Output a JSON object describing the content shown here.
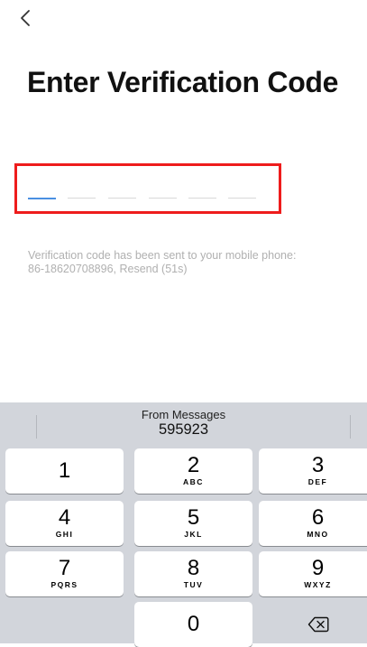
{
  "header": {
    "back_icon": "chevron-left-icon"
  },
  "title": "Enter Verification Code",
  "code_input": {
    "slots": [
      "",
      "",
      "",
      "",
      "",
      ""
    ],
    "active_index": 0
  },
  "hint": {
    "line1": "Verification code has been sent to your mobile phone:",
    "line2": "86-18620708896, Resend (51s)"
  },
  "keyboard": {
    "suggestion": {
      "source": "From Messages",
      "code": "595923"
    },
    "keys": [
      {
        "num": "1",
        "letters": ""
      },
      {
        "num": "2",
        "letters": "ABC"
      },
      {
        "num": "3",
        "letters": "DEF"
      },
      {
        "num": "4",
        "letters": "GHI"
      },
      {
        "num": "5",
        "letters": "JKL"
      },
      {
        "num": "6",
        "letters": "MNO"
      },
      {
        "num": "7",
        "letters": "PQRS"
      },
      {
        "num": "8",
        "letters": "TUV"
      },
      {
        "num": "9",
        "letters": "WXYZ"
      },
      {
        "num": "0",
        "letters": ""
      }
    ],
    "delete_icon": "backspace-icon"
  },
  "colors": {
    "highlight_border": "#ee1c1c",
    "active_slot": "#4a90e2",
    "hint_text": "#b0b0b0",
    "keyboard_bg": "#d2d5db"
  }
}
